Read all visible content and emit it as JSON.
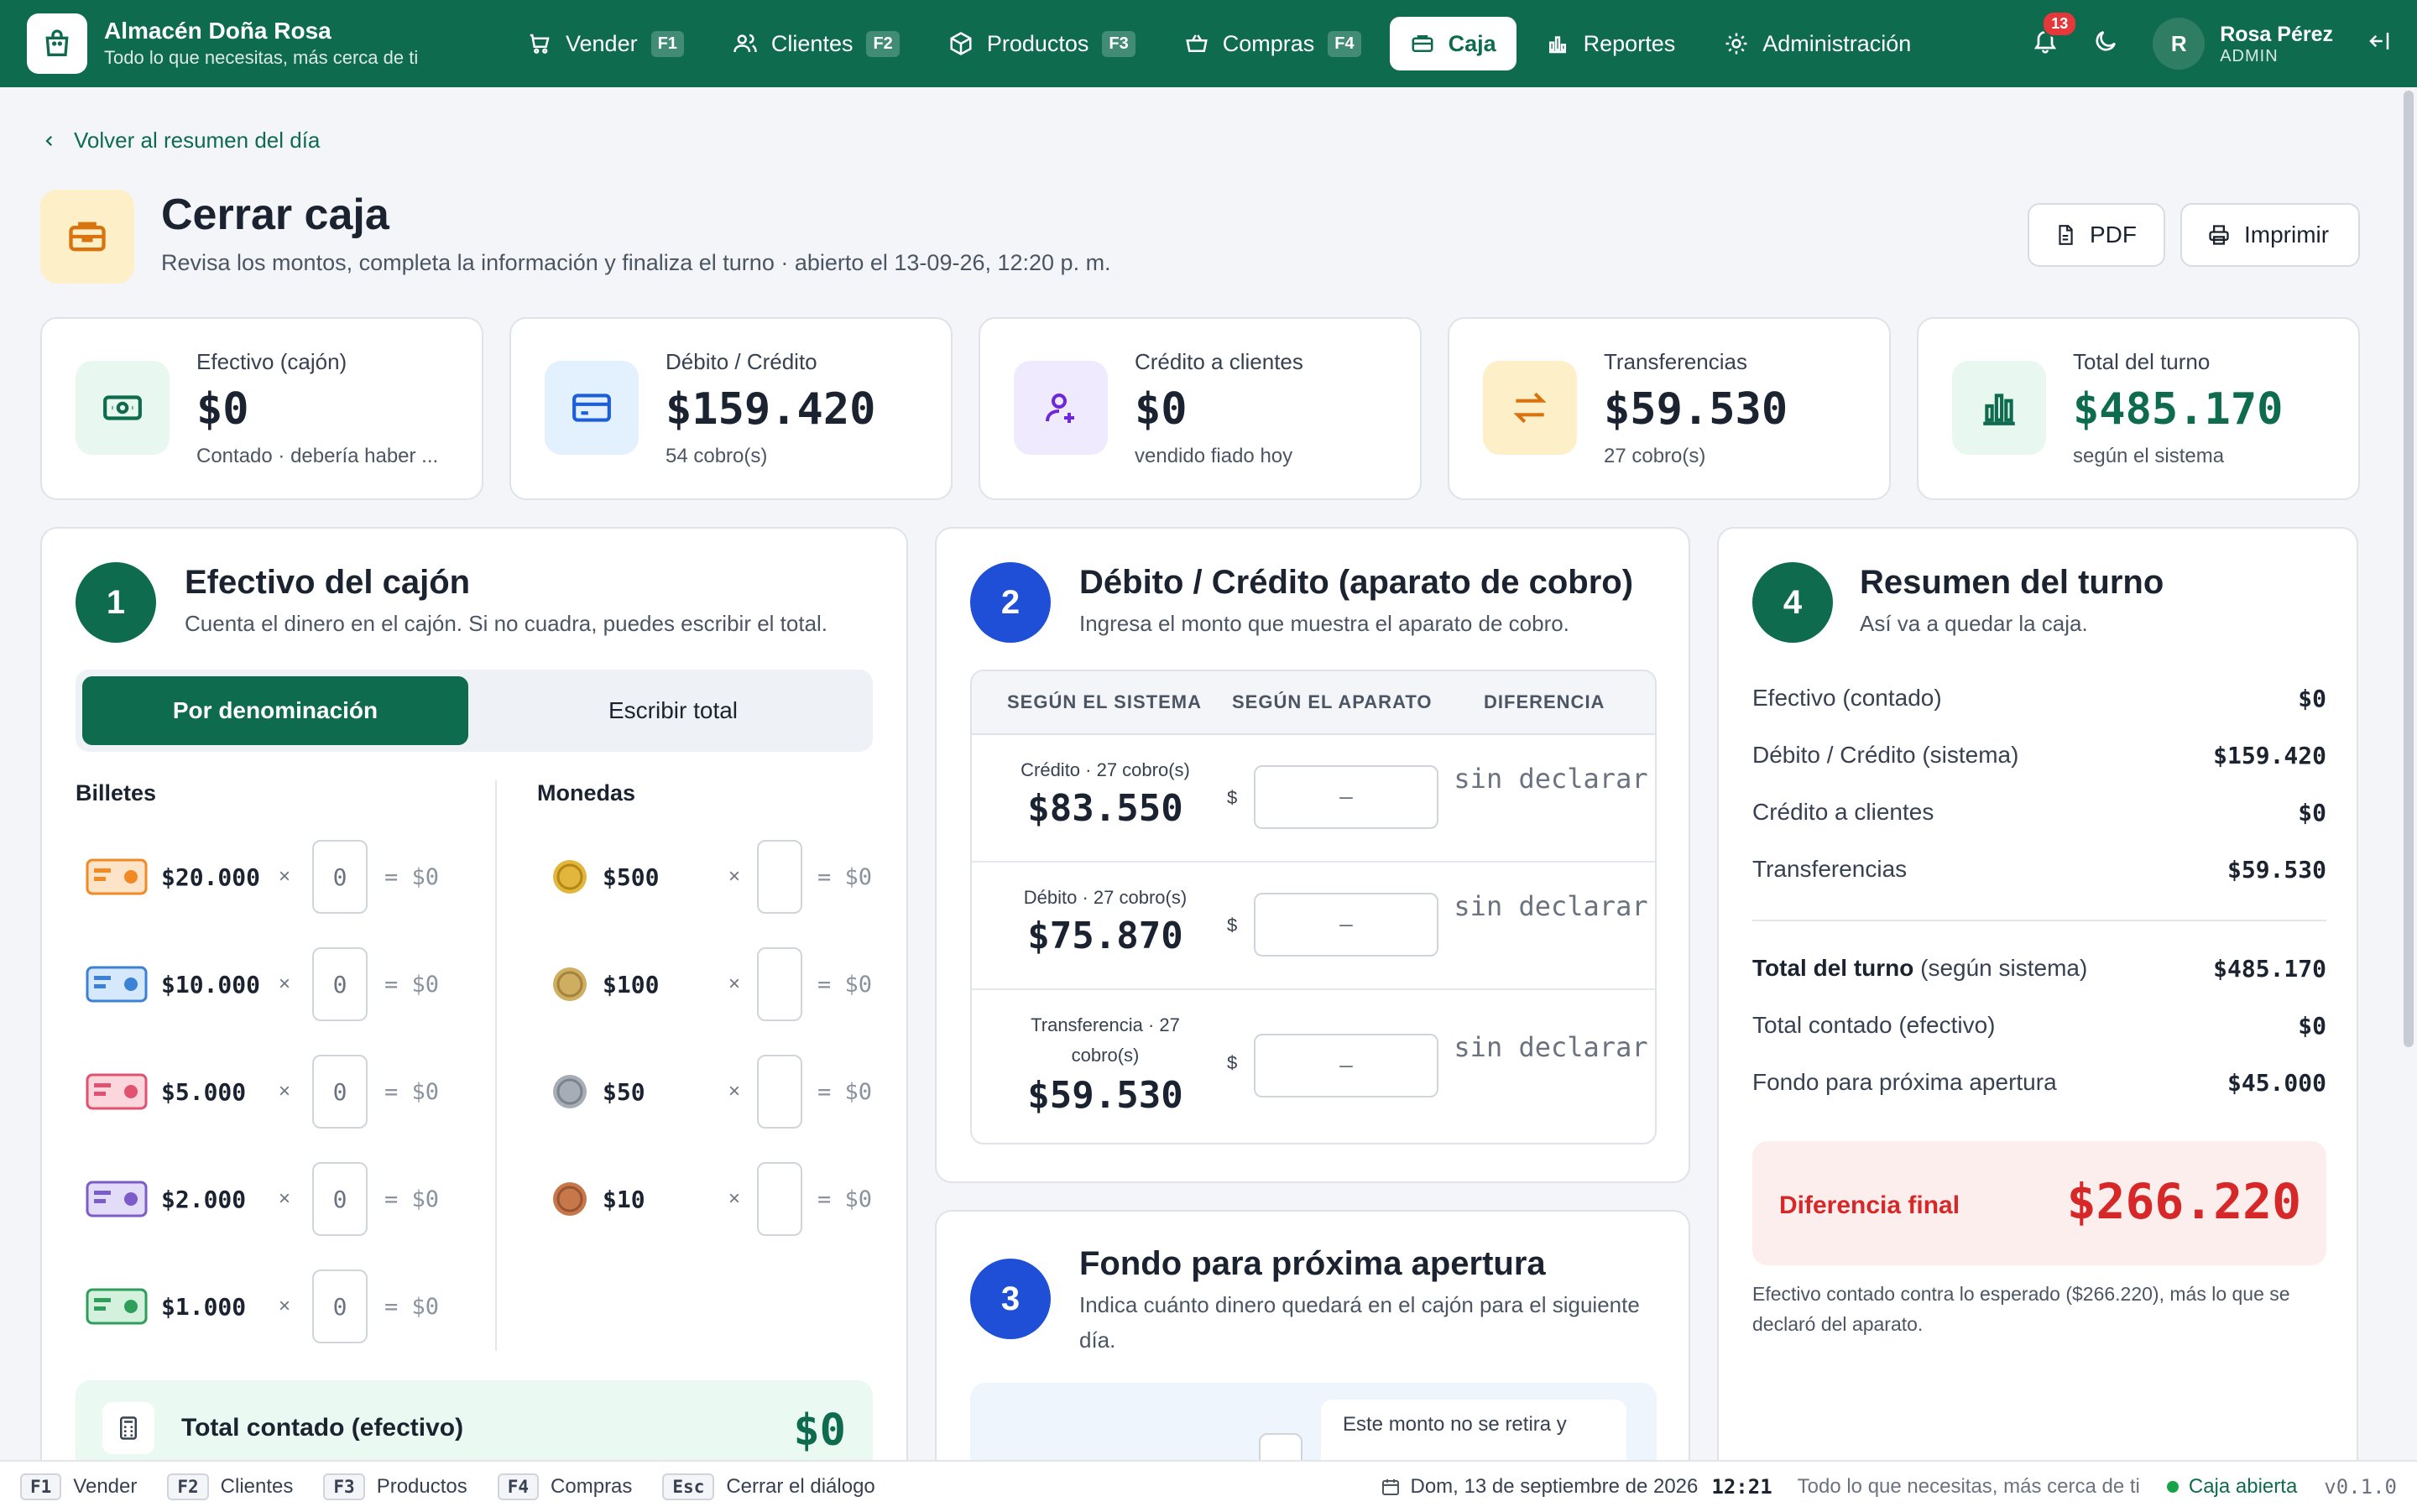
{
  "app": {
    "name": "Almacén Doña Rosa",
    "tagline": "Todo lo que necesitas, más cerca de ti"
  },
  "nav": {
    "items": [
      {
        "label": "Vender",
        "key": "F1"
      },
      {
        "label": "Clientes",
        "key": "F2"
      },
      {
        "label": "Productos",
        "key": "F3"
      },
      {
        "label": "Compras",
        "key": "F4"
      },
      {
        "label": "Caja",
        "key": ""
      },
      {
        "label": "Reportes",
        "key": ""
      },
      {
        "label": "Administración",
        "key": ""
      }
    ],
    "notifications": "13",
    "user": {
      "initial": "R",
      "name": "Rosa Pérez",
      "role": "ADMIN"
    }
  },
  "header": {
    "back": "Volver al resumen del día",
    "title": "Cerrar caja",
    "subtitle": "Revisa los montos, completa la información y finaliza el turno · abierto el 13-09-26, 12:20 p. m.",
    "pdf": "PDF",
    "print": "Imprimir"
  },
  "stats": [
    {
      "label": "Efectivo (cajón)",
      "value": "$0",
      "note": "Contado · debería haber ..."
    },
    {
      "label": "Débito / Crédito",
      "value": "$159.420",
      "note": "54 cobro(s)"
    },
    {
      "label": "Crédito a clientes",
      "value": "$0",
      "note": "vendido fiado hoy"
    },
    {
      "label": "Transferencias",
      "value": "$59.530",
      "note": "27 cobro(s)"
    },
    {
      "label": "Total del turno",
      "value": "$485.170",
      "note": "según el sistema"
    }
  ],
  "cash": {
    "step": "1",
    "title": "Efectivo del cajón",
    "subtitle": "Cuenta el dinero en el cajón. Si no cuadra, puedes escribir el total.",
    "tab_on": "Por denominación",
    "tab_off": "Escribir total",
    "bills_label": "Billetes",
    "coins_label": "Monedas",
    "times": "×",
    "bills": [
      {
        "amount": "$20.000",
        "input": "0",
        "result": "= $0"
      },
      {
        "amount": "$10.000",
        "input": "0",
        "result": "= $0"
      },
      {
        "amount": "$5.000",
        "input": "0",
        "result": "= $0"
      },
      {
        "amount": "$2.000",
        "input": "0",
        "result": "= $0"
      },
      {
        "amount": "$1.000",
        "input": "0",
        "result": "= $0"
      }
    ],
    "coins": [
      {
        "amount": "$500",
        "input": "",
        "result": "= $0"
      },
      {
        "amount": "$100",
        "input": "",
        "result": "= $0"
      },
      {
        "amount": "$50",
        "input": "",
        "result": "= $0"
      },
      {
        "amount": "$10",
        "input": "",
        "result": "= $0"
      }
    ],
    "total_label": "Total contado (efectivo)",
    "total_value": "$0"
  },
  "card": {
    "step": "2",
    "title": "Débito / Crédito (aparato de cobro)",
    "subtitle": "Ingresa el monto que muestra el aparato de cobro.",
    "headers": [
      "SEGÚN EL SISTEMA",
      "SEGÚN EL APARATO",
      "DIFERENCIA"
    ],
    "currency": "$",
    "rows": [
      {
        "label": "Crédito · 27 cobro(s)",
        "value": "$83.550",
        "input": "—",
        "diff": "sin declarar"
      },
      {
        "label": "Débito · 27 cobro(s)",
        "value": "$75.870",
        "input": "—",
        "diff": "sin declarar"
      },
      {
        "label": "Transferencia · 27 cobro(s)",
        "value": "$59.530",
        "input": "—",
        "diff": "sin declarar"
      }
    ]
  },
  "fund": {
    "step": "3",
    "title": "Fondo para próxima apertura",
    "subtitle": "Indica cuánto dinero quedará en el cajón para el siguiente día.",
    "note": "Este monto no se retira y"
  },
  "summary": {
    "step": "4",
    "title": "Resumen del turno",
    "subtitle": "Así va a quedar la caja.",
    "rows": [
      {
        "label": "Efectivo (contado)",
        "value": "$0"
      },
      {
        "label": "Débito / Crédito (sistema)",
        "value": "$159.420"
      },
      {
        "label": "Crédito a clientes",
        "value": "$0"
      },
      {
        "label": "Transferencias",
        "value": "$59.530"
      }
    ],
    "total_label": "Total del turno",
    "total_qualifier": "(según sistema)",
    "total_value": "$485.170",
    "counted_label": "Total contado (efectivo)",
    "counted_value": "$0",
    "fund_label": "Fondo para próxima apertura",
    "fund_value": "$45.000",
    "diff_label": "Diferencia final",
    "diff_value": "$266.220",
    "diff_note": "Efectivo contado contra lo esperado ($266.220), más lo que se declaró del aparato."
  },
  "footer": {
    "shortcuts": [
      {
        "key": "F1",
        "label": "Vender"
      },
      {
        "key": "F2",
        "label": "Clientes"
      },
      {
        "key": "F3",
        "label": "Productos"
      },
      {
        "key": "F4",
        "label": "Compras"
      },
      {
        "key": "Esc",
        "label": "Cerrar el diálogo"
      }
    ],
    "date": "Dom, 13 de septiembre de 2026",
    "time": "12:21",
    "tagline": "Todo lo que necesitas, más cerca de ti",
    "status": "Caja abierta",
    "version": "v0.1.0"
  },
  "colors": {
    "brand": "#0e6b4e",
    "danger": "#d62828",
    "step_blue": "#1f4fd6"
  }
}
